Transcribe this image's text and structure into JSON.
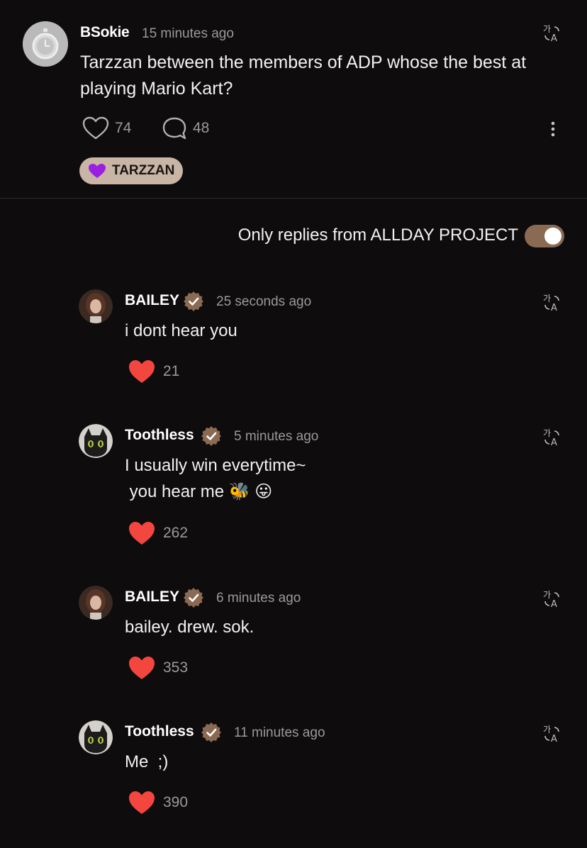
{
  "post": {
    "username": "BSokie",
    "time": "15 minutes ago",
    "text": "Tarzzan between the members of ADP whose the best at playing Mario Kart?",
    "like_count": "74",
    "comment_count": "48",
    "tag_label": "TARZZAN",
    "tag_heart_color": "#9b1fe0"
  },
  "filter": {
    "label": "Only replies from ALLDAY PROJECT",
    "enabled": true,
    "toggle_color": "#8a6a52"
  },
  "replies": [
    {
      "name": "BAILEY",
      "time": "25 seconds ago",
      "text": "i dont hear you",
      "likes": "21"
    },
    {
      "name": "Toothless",
      "time": "5 minutes ago",
      "text": "I usually win everytime~\n you hear me 🐝 😛",
      "likes": "262"
    },
    {
      "name": "BAILEY",
      "time": "6 minutes ago",
      "text": "bailey. drew. sok.",
      "likes": "353"
    },
    {
      "name": "Toothless",
      "time": "11 minutes ago",
      "text": "Me  ;)",
      "likes": "390"
    }
  ],
  "colors": {
    "background": "#0e0c0c",
    "like_heart": "#f2463e",
    "verified_badge": "#8a6a52"
  }
}
